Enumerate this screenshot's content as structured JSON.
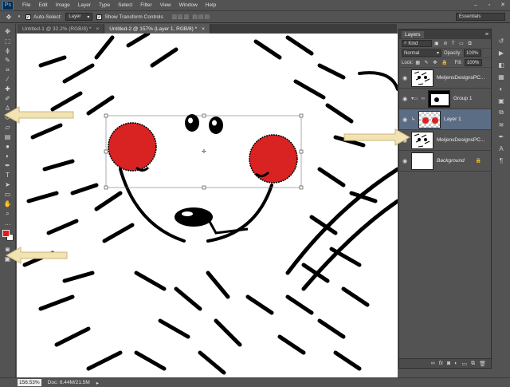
{
  "app": {
    "logo": "Ps"
  },
  "menu": [
    "File",
    "Edit",
    "Image",
    "Layer",
    "Type",
    "Select",
    "Filter",
    "View",
    "Window",
    "Help"
  ],
  "options_bar": {
    "auto_select_label": "Auto-Select:",
    "auto_select_value": "Layer",
    "show_transform_label": "Show Transform Controls",
    "workspace": "Essentials"
  },
  "tabs": [
    {
      "label": "Untitled-1 @ 32.2% (RGB/8) *",
      "close": "×"
    },
    {
      "label": "Untitled-2 @ 157% (Layer 1, RGB/8) *",
      "close": "×"
    }
  ],
  "layers_panel": {
    "tab": "Layers",
    "filter_kind": "Kind",
    "blend_mode": "Normal",
    "opacity_label": "Opacity:",
    "opacity_value": "100%",
    "lock_label": "Lock:",
    "fill_label": "Fill:",
    "fill_value": "100%",
    "layers": [
      {
        "name": "MeljensDesignsPC...",
        "selected": false
      },
      {
        "name": "Group 1",
        "selected": false
      },
      {
        "name": "Layer 1",
        "selected": true
      },
      {
        "name": "MeljensDesignsPC...",
        "selected": false
      },
      {
        "name": "Background",
        "selected": false
      }
    ]
  },
  "status_bar": {
    "zoom": "156.53%",
    "doc": "Doc: 6.44M/21.5M"
  },
  "colors": {
    "foreground": "#e31b1b",
    "background": "#ffffff",
    "accent_arrow": "#f2e3b3",
    "selected_layer": "#5b6d85"
  },
  "icons": [
    "move-tool-icon",
    "marquee-tool-icon",
    "lasso-tool-icon",
    "quick-select-icon",
    "crop-tool-icon",
    "eyedropper-icon",
    "healing-brush-icon",
    "brush-tool-icon",
    "clone-stamp-icon",
    "history-brush-icon",
    "eraser-icon",
    "gradient-icon",
    "blur-icon",
    "dodge-icon",
    "pen-tool-icon",
    "type-tool-icon",
    "path-select-icon",
    "shape-tool-icon",
    "hand-tool-icon",
    "zoom-tool-icon"
  ]
}
